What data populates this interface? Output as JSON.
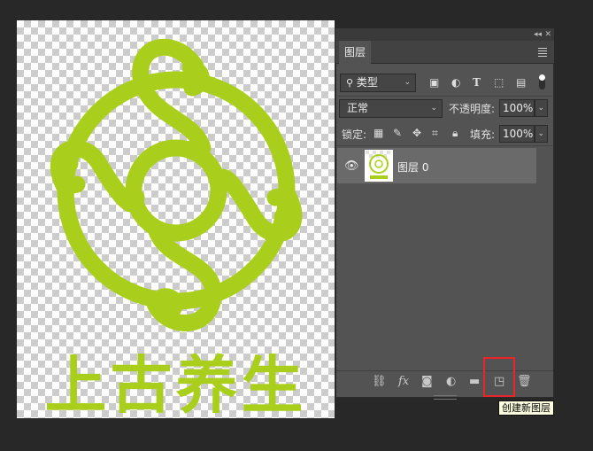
{
  "canvas": {
    "brand_text": "上古养生",
    "watermark": "",
    "logo_color": "#a9cf1c"
  },
  "panel": {
    "tab_label": "图层",
    "filter": {
      "icon": "search-icon",
      "label": "类型"
    },
    "blend_mode": "正常",
    "opacity_label": "不透明度:",
    "opacity_value": "100%",
    "lock_label": "锁定:",
    "fill_label": "填充:",
    "fill_value": "100%",
    "layers": [
      {
        "name": "图层 0",
        "visible": true
      }
    ],
    "bottom_icons": [
      "link-icon",
      "fx-icon",
      "mask-icon",
      "adjustment-icon",
      "folder-icon",
      "new-layer-icon",
      "trash-icon"
    ],
    "fx_label": "fx"
  },
  "tooltip": {
    "text": "创建新图层"
  },
  "colors": {
    "app_bg": "#282828",
    "panel_bg": "#535353",
    "selected_layer": "#6a6a6a",
    "highlight": "#e8262a",
    "tooltip_bg": "#ffffe1"
  }
}
